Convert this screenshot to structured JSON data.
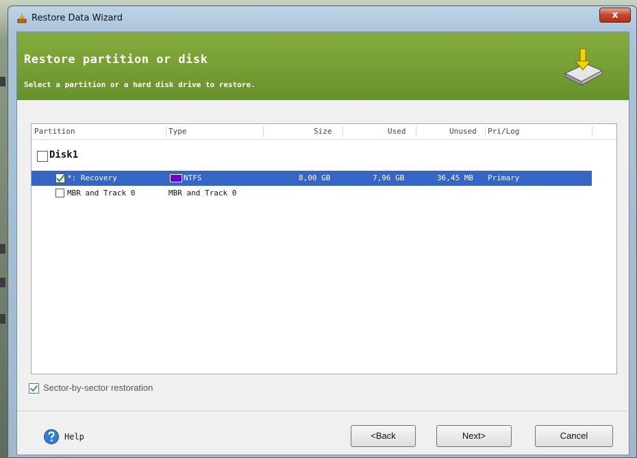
{
  "window": {
    "title": "Restore Data Wizard",
    "close_glyph": "x"
  },
  "banner": {
    "title": "Restore partition or disk",
    "subtitle": "Select a partition or a hard disk drive to restore.",
    "icon": "hard-disk-download-icon"
  },
  "table": {
    "columns": [
      "Partition",
      "Type",
      "Size",
      "Used",
      "Unused",
      "Pri/Log"
    ],
    "disk": {
      "label": "Disk1",
      "checked": false
    },
    "rows": [
      {
        "checked": true,
        "selected": true,
        "partition": "*: Recovery",
        "type": "NTFS",
        "type_color": "#6a00d6",
        "size": "8,00 GB",
        "used": "7,96 GB",
        "unused": "36,45 MB",
        "prilog": "Primary"
      },
      {
        "checked": false,
        "selected": false,
        "partition": "MBR and Track 0",
        "type": "MBR and Track 0",
        "size": "",
        "used": "",
        "unused": "",
        "prilog": ""
      }
    ]
  },
  "options": {
    "sector_by_sector": {
      "label": "Sector-by-sector restoration",
      "checked": true
    }
  },
  "footer": {
    "help": "Help",
    "back": "<Back",
    "next": "Next>",
    "cancel": "Cancel"
  },
  "colors": {
    "banner_green": "#6e9830",
    "selection_blue": "#3565c5",
    "check_green": "#2e9a2e"
  }
}
